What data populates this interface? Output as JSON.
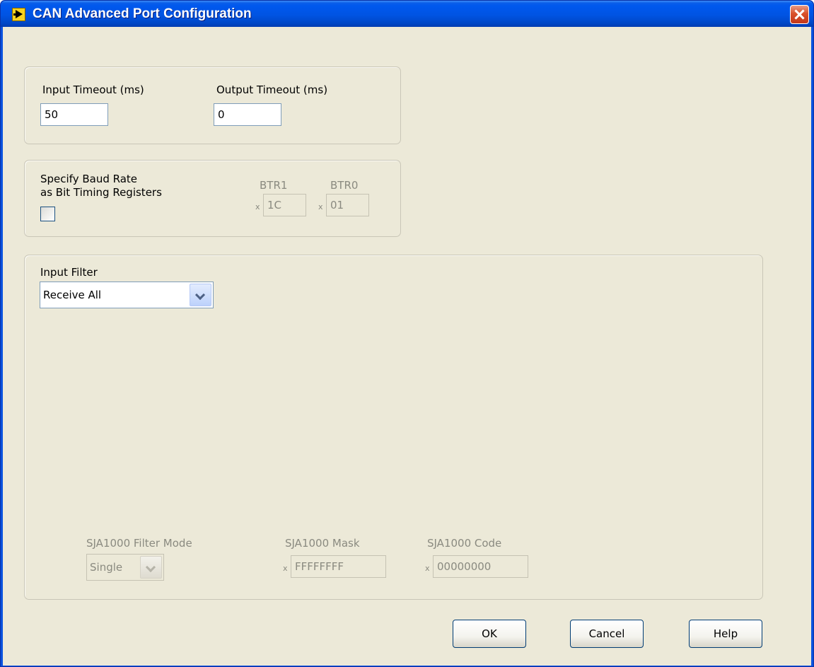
{
  "window": {
    "title": "CAN Advanced Port Configuration"
  },
  "timeouts": {
    "input_label": "Input Timeout (ms)",
    "input_value": "50",
    "output_label": "Output Timeout (ms)",
    "output_value": "0"
  },
  "baud": {
    "label_line1": "Specify Baud Rate",
    "label_line2": "as Bit Timing Registers",
    "checked": false,
    "btr1_label": "BTR1",
    "btr1_radix": "x",
    "btr1_value": "1C",
    "btr0_label": "BTR0",
    "btr0_radix": "x",
    "btr0_value": "01"
  },
  "filter": {
    "label": "Input Filter",
    "selected": "Receive All",
    "mode_label": "SJA1000 Filter Mode",
    "mode_value": "Single",
    "mask_label": "SJA1000 Mask",
    "mask_radix": "x",
    "mask_value": "FFFFFFFF",
    "code_label": "SJA1000 Code",
    "code_radix": "x",
    "code_value": "00000000"
  },
  "buttons": {
    "ok": "OK",
    "cancel": "Cancel",
    "help": "Help"
  },
  "colors": {
    "titlebar": "#0054e3",
    "face": "#ece9d8",
    "close": "#d9512b"
  },
  "icons": {
    "app": "labview-vi-icon",
    "close": "close-icon",
    "dropdown": "chevron-down-icon"
  }
}
